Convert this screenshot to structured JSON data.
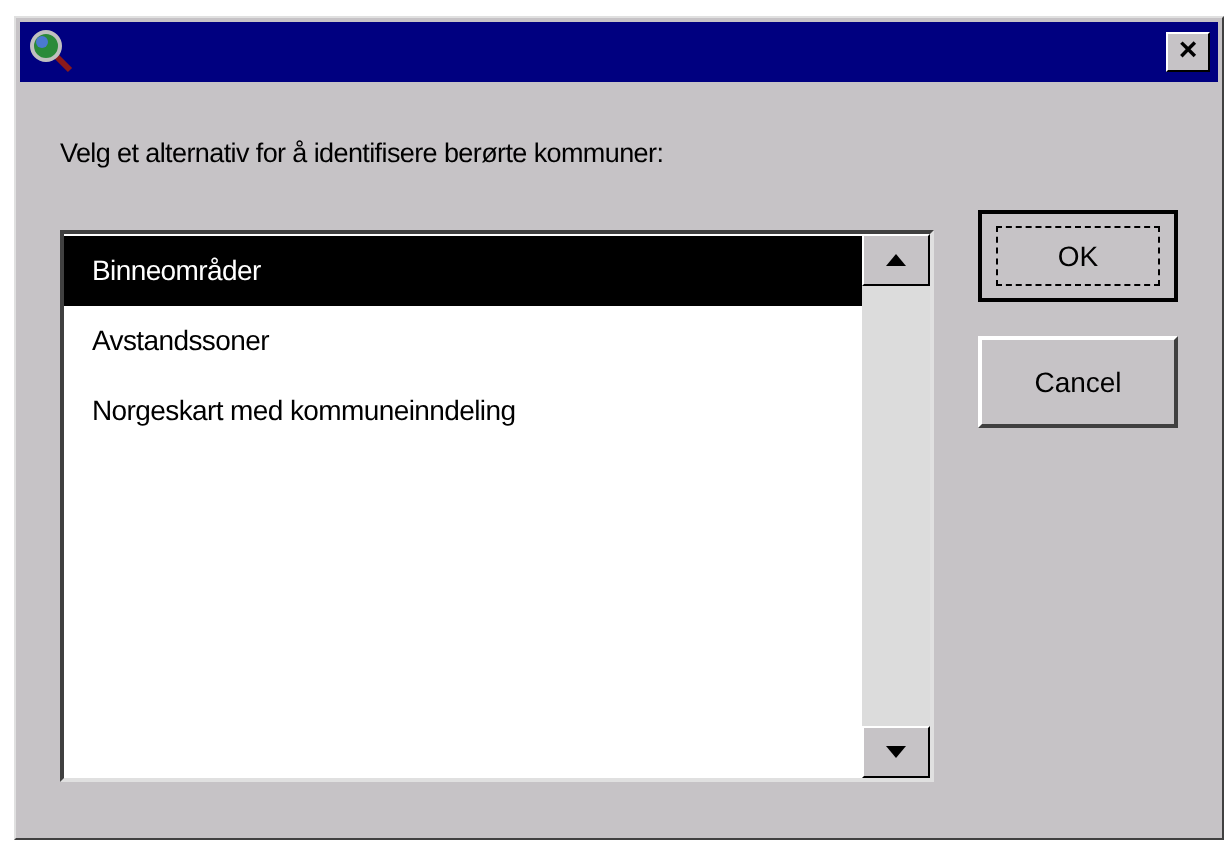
{
  "window": {
    "close": "×"
  },
  "prompt": "Velg et alternativ for å identifisere berørte kommuner:",
  "list": {
    "items": [
      {
        "label": "Binneområder",
        "selected": true
      },
      {
        "label": "Avstandssoner",
        "selected": false
      },
      {
        "label": "Norgeskart med kommuneinndeling",
        "selected": false
      }
    ]
  },
  "buttons": [
    {
      "label": "OK",
      "focused": true
    },
    {
      "label": "Cancel",
      "focused": false
    }
  ]
}
